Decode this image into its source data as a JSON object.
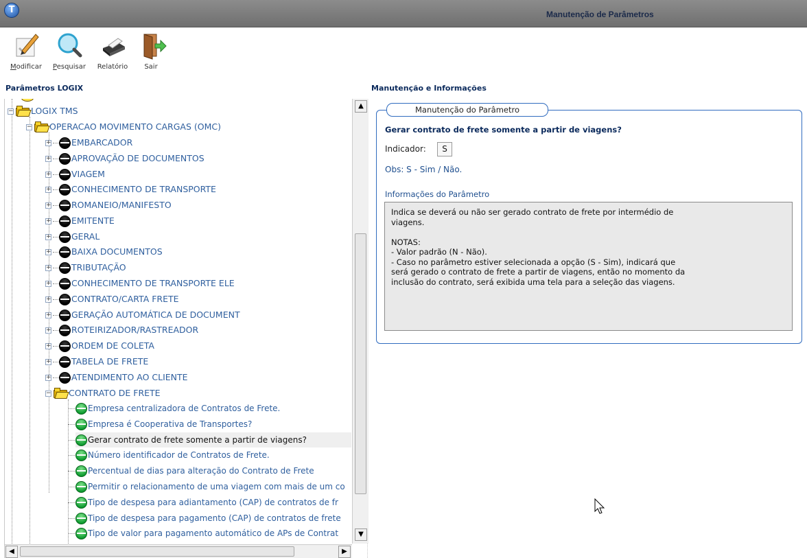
{
  "window": {
    "title": "Manutenção de Parâmetros",
    "app_icon_letter": "T"
  },
  "toolbar": {
    "buttons": [
      {
        "key": "M",
        "rest": "odificar",
        "icon": "pencil-check-icon"
      },
      {
        "key": "P",
        "rest": "esquisar",
        "icon": "magnifier-icon"
      },
      {
        "key": "",
        "rest": "Relatório",
        "icon": "printer-icon"
      },
      {
        "key": "",
        "rest": "Sair",
        "icon": "exit-door-icon"
      }
    ]
  },
  "left_panel": {
    "title": "Parâmetros LOGIX",
    "tree": {
      "root": "LOGIX TMS",
      "group": "OPERACAO MOVIMENTO CARGAS (OMC)",
      "children": [
        "EMBARCADOR",
        "APROVAÇÃO DE DOCUMENTOS",
        "VIAGEM",
        "CONHECIMENTO DE TRANSPORTE",
        "ROMANEIO/MANIFESTO",
        "EMITENTE",
        "GERAL",
        "BAIXA DOCUMENTOS",
        "TRIBUTAÇÃO",
        "CONHECIMENTO DE TRANSPORTE ELE",
        "CONTRATO/CARTA FRETE",
        "GERAÇÃO AUTOMÁTICA DE DOCUMENT",
        "ROTEIRIZADOR/RASTREADOR",
        "ORDEM DE COLETA",
        "TABELA DE FRETE",
        "ATENDIMENTO AO CLIENTE"
      ],
      "open_folder": "CONTRATO DE FRETE",
      "leaves": [
        "Empresa centralizadora de Contratos de Frete.",
        "Empresa é Cooperativa de Transportes?",
        "Gerar contrato de frete somente a partir de viagens?",
        "Número identificador de Contratos de Frete.",
        "Percentual de dias para alteração do Contrato de Frete",
        "Permitir o relacionamento de uma viagem com mais de um co",
        "Tipo de despesa para adiantamento (CAP) de contratos de fr",
        "Tipo de despesa para pagamento (CAP) de contratos de frete",
        "Tipo de valor para pagamento automático de APs de Contrat"
      ],
      "selected_leaf_index": 2
    }
  },
  "right_panel": {
    "title": "Manutenção e Informações",
    "fieldset_legend": "Manutenção do Parâmetro",
    "question": "Gerar contrato de frete somente a partir de viagens?",
    "indicator_label": "Indicador:",
    "indicator_value": "S",
    "obs": "Obs: S - Sim / Não.",
    "info_title": "Informações do Parâmetro",
    "info_text": "Indica se deverá ou não ser gerado contrato de frete por intermédio de\nviagens.\n\nNOTAS:\n- Valor padrão (N - Não).\n- Caso no parâmetro estiver selecionada a opção (S - Sim), indicará que\nserá gerado o contrato de frete a partir de viagens, então no momento da\ninclusão do contrato, será exibida uma tela para a seleção das viagens."
  },
  "colors": {
    "accent_blue": "#2f6bbf",
    "tree_text": "#2f5f9e",
    "header_text": "#0b2a5c"
  }
}
